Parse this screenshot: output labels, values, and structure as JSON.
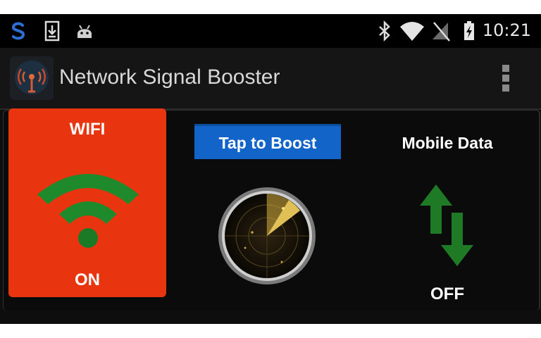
{
  "status_bar": {
    "time": "10:21",
    "left_icons": [
      "swype-s-icon",
      "download-icon",
      "android-icon"
    ],
    "right_icons": [
      "bluetooth-icon",
      "wifi-signal-icon",
      "cellular-no-signal-icon",
      "battery-charging-icon"
    ]
  },
  "app_bar": {
    "title": "Network Signal Booster",
    "logo_icon": "antenna-signal-icon",
    "menu_icon": "overflow-menu-icon"
  },
  "wifi": {
    "title": "WIFI",
    "state": "ON",
    "icon": "wifi-icon",
    "card_color": "#e8350f",
    "icon_color": "#1f8a2c"
  },
  "boost": {
    "button_label": "Tap to Boost",
    "button_color": "#1264c8",
    "icon": "radar-icon"
  },
  "mobile_data": {
    "title": "Mobile Data",
    "state": "OFF",
    "icon": "data-transfer-arrows-icon",
    "icon_color": "#1f7a25"
  }
}
